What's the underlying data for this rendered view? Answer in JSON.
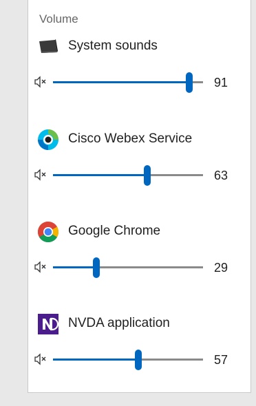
{
  "panel": {
    "heading": "Volume"
  },
  "apps": [
    {
      "name": "System sounds",
      "icon": "speaker-device-icon",
      "volume": 91
    },
    {
      "name": "Cisco Webex Service",
      "icon": "webex-logo-icon",
      "volume": 63
    },
    {
      "name": "Google Chrome",
      "icon": "chrome-logo-icon",
      "volume": 29
    },
    {
      "name": "NVDA application",
      "icon": "nvda-logo-icon",
      "volume": 57
    }
  ],
  "colors": {
    "accent": "#0067c0",
    "track": "#8a8a8a",
    "nvda_purple": "#4b1d8c"
  }
}
